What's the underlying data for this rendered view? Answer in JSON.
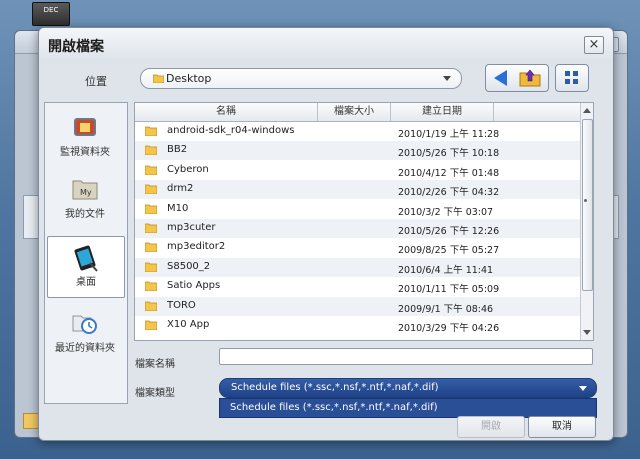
{
  "desktop": {
    "task_icon_label": "DEC"
  },
  "dialog": {
    "title": "開啟檔案",
    "close_label": "×",
    "location": {
      "label": "位置",
      "value": "Desktop"
    },
    "places": [
      {
        "label": "監視資料夾",
        "icon": "monitored-folder-icon"
      },
      {
        "label": "我的文件",
        "icon": "my-documents-icon"
      },
      {
        "label": "桌面",
        "icon": "desktop-icon"
      },
      {
        "label": "最近的資料夾",
        "icon": "recent-folders-icon"
      }
    ],
    "columns": {
      "name": "名稱",
      "size": "檔案大小",
      "date": "建立日期"
    },
    "files": [
      {
        "name": "android-sdk_r04-windows",
        "date": "2010/1/19 上午 11:28"
      },
      {
        "name": "BB2",
        "date": "2010/5/26 下午 10:18"
      },
      {
        "name": "Cyberon",
        "date": "2010/4/12 下午 01:48"
      },
      {
        "name": "drm2",
        "date": "2010/2/26 下午 04:32"
      },
      {
        "name": "M10",
        "date": "2010/3/2 下午 03:07"
      },
      {
        "name": "mp3cuter",
        "date": "2010/5/26 下午 12:26"
      },
      {
        "name": "mp3editor2",
        "date": "2009/8/25 下午 05:27"
      },
      {
        "name": "S8500_2",
        "date": "2010/6/4 上午 11:41"
      },
      {
        "name": "Satio Apps",
        "date": "2010/1/11 下午 05:09"
      },
      {
        "name": "TORO",
        "date": "2009/9/1 下午 08:46"
      },
      {
        "name": "X10 App",
        "date": "2010/3/29 下午 04:26"
      }
    ],
    "filename": {
      "label": "檔案名稱",
      "value": ""
    },
    "filetype": {
      "label": "檔案類型",
      "value": "Schedule files (*.ssc,*.nsf,*.ntf,*.naf,*.dif)",
      "options": [
        "Schedule files (*.ssc,*.nsf,*.ntf,*.naf,*.dif)"
      ]
    },
    "buttons": {
      "open": "開啟",
      "cancel": "取消"
    },
    "colors": {
      "selection": "#2a4f96",
      "back_arrow": "#2a6fd6",
      "row_alt": "#eef1f6"
    }
  }
}
